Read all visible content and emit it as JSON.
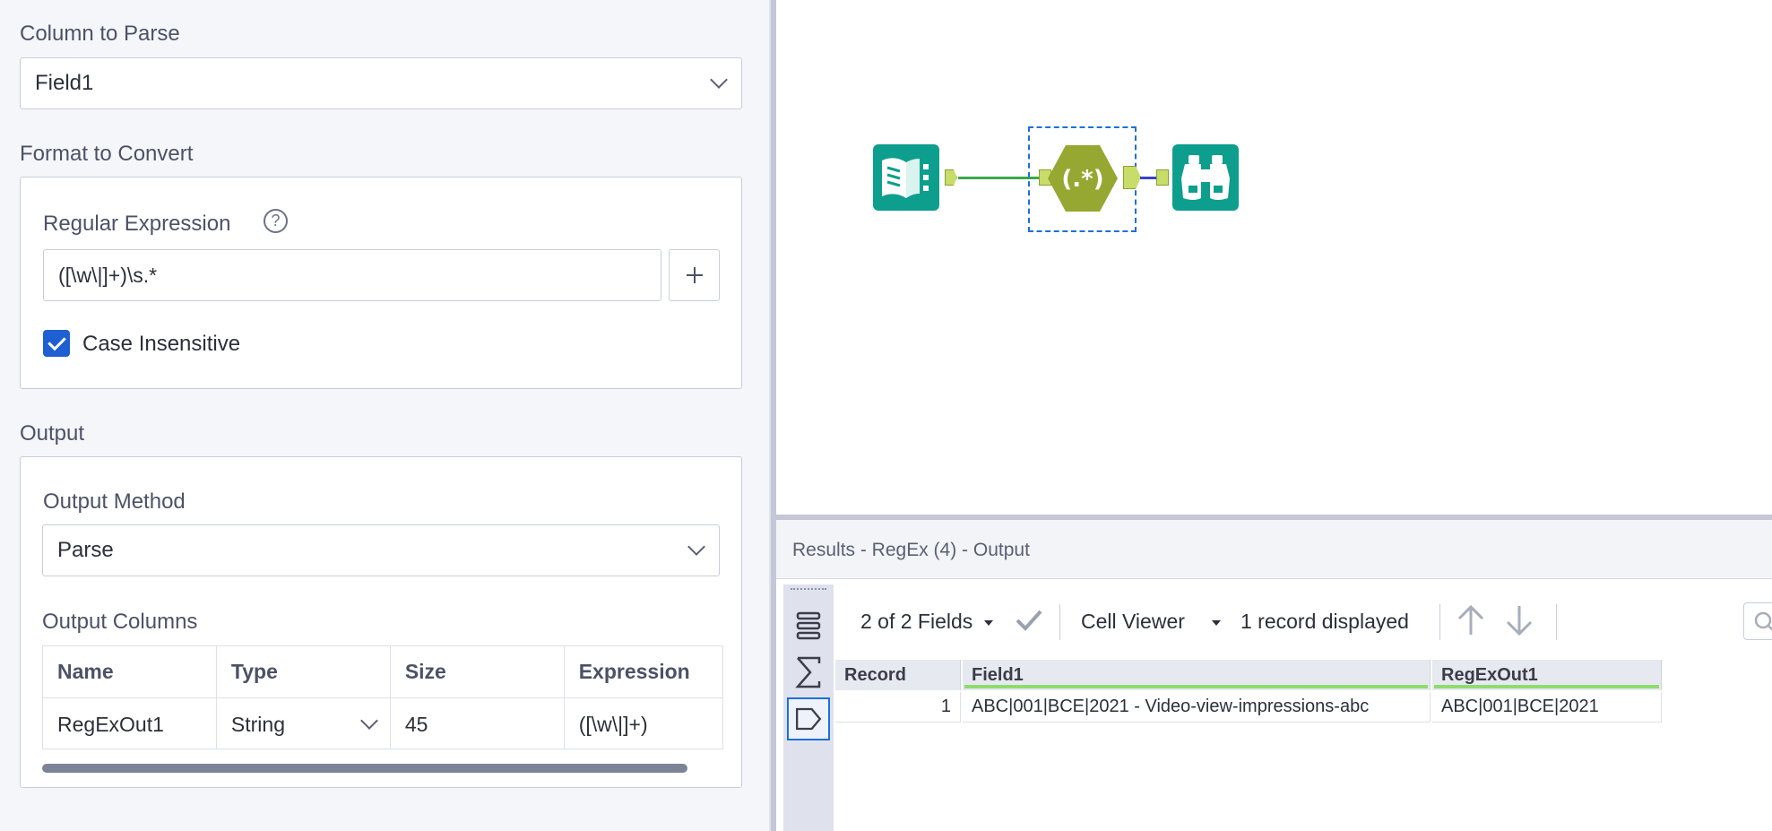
{
  "config": {
    "column_to_parse": {
      "label": "Column to Parse",
      "value": "Field1"
    },
    "format_to_convert": {
      "label": "Format to Convert",
      "regex_label": "Regular Expression",
      "help_glyph": "?",
      "regex_value": "([\\w\\|]+)\\s.*",
      "case_insensitive_label": "Case Insensitive",
      "case_insensitive_checked": true
    },
    "output": {
      "label": "Output",
      "method_label": "Output Method",
      "method_value": "Parse",
      "columns_label": "Output Columns",
      "columns_headers": [
        "Name",
        "Type",
        "Size",
        "Expression"
      ],
      "columns_rows": [
        {
          "name": "RegExOut1",
          "type": "String",
          "size": "45",
          "expression": "([\\w\\|]+)"
        }
      ]
    }
  },
  "canvas": {
    "tools": [
      {
        "name": "input-data-tool",
        "icon": "book-icon",
        "color": "#0e9e8e"
      },
      {
        "name": "regex-tool",
        "icon": "regex-hexagon-icon",
        "glyph": "(.*)",
        "color": "#96a832",
        "selected": true
      },
      {
        "name": "browse-tool",
        "icon": "binoculars-icon",
        "color": "#0e9e8e"
      }
    ]
  },
  "results": {
    "title": "Results - RegEx (4) - Output",
    "fields_selector": "2 of 2 Fields",
    "cell_viewer": "Cell Viewer",
    "records_displayed": "1 record displayed",
    "grid": {
      "headers": [
        "Record",
        "Field1",
        "RegExOut1"
      ],
      "rows": [
        {
          "record": "1",
          "field1": "ABC|001|BCE|2021 - Video-view-impressions-abc",
          "regexout1": "ABC|001|BCE|2021"
        }
      ]
    }
  },
  "colors": {
    "accent_blue": "#1e6fd9",
    "tool_teal": "#0e9e8e",
    "regex_olive": "#96a832",
    "header_underline": "#8fdc6e"
  }
}
